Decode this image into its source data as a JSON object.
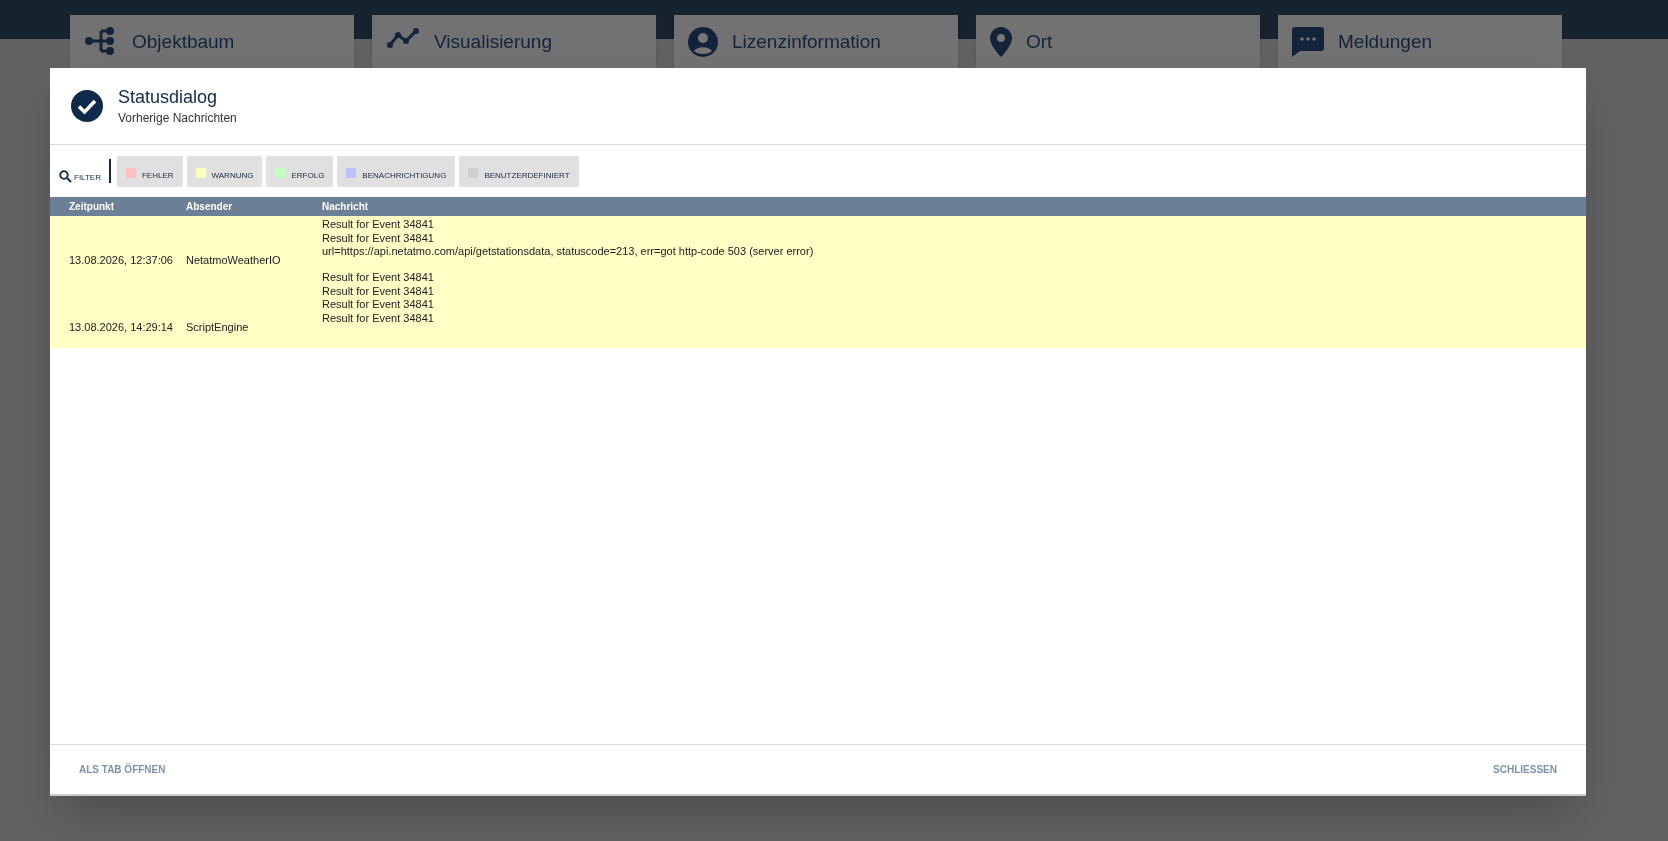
{
  "nav_tabs": [
    {
      "label": "Objektbaum"
    },
    {
      "label": "Visualisierung"
    },
    {
      "label": "Lizenzinformation"
    },
    {
      "label": "Ort"
    },
    {
      "label": "Meldungen"
    }
  ],
  "dialog": {
    "title": "Statusdialog",
    "subtitle": "Vorherige Nachrichten",
    "filter": {
      "label": "FILTER",
      "chips": [
        {
          "label": "FEHLER",
          "color": "#ffc0c0"
        },
        {
          "label": "WARNUNG",
          "color": "#ffffc0"
        },
        {
          "label": "ERFOLG",
          "color": "#c0ffc0"
        },
        {
          "label": "BENACHRICHTIGUNG",
          "color": "#c0c0ff"
        },
        {
          "label": "BENUTZERDEFINIERT",
          "color": "#d0d0d0"
        }
      ]
    },
    "table": {
      "columns": [
        "Zeitpunkt",
        "Absender",
        "Nachricht"
      ],
      "rows": [
        {
          "kind": "clipped",
          "message": "Result for Event 34841"
        },
        {
          "kind": "clipped",
          "message": "Result for Event 34841"
        },
        {
          "kind": "full",
          "time": "13.08.2026, 12:37:06",
          "sender": "NetatmoWeatherIO",
          "message": "url=https://api.netatmo.com/api/getstationsdata, statuscode=213, err=got http-code 503 (server error)"
        },
        {
          "kind": "clipped",
          "message": "Result for Event 34841"
        },
        {
          "kind": "clipped",
          "message": "Result for Event 34841"
        },
        {
          "kind": "clipped",
          "message": "Result for Event 34841"
        },
        {
          "kind": "full",
          "time": "13.08.2026, 14:29:14",
          "sender": "ScriptEngine",
          "message": "Result for Event 34841"
        }
      ]
    },
    "footer": {
      "left_button": "ALS TAB ÖFFNEN",
      "right_button": "SCHLIESSEN"
    }
  }
}
